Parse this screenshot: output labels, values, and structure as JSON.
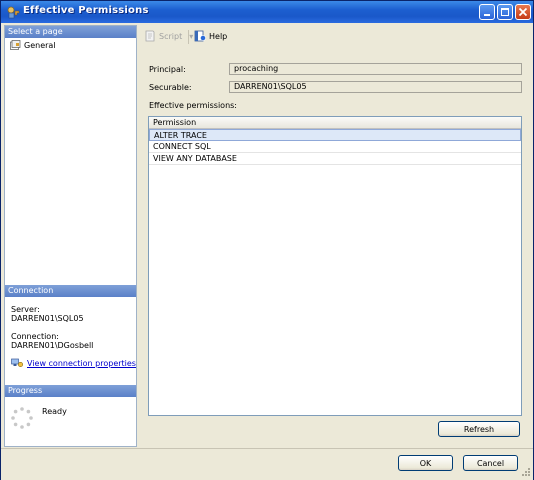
{
  "window": {
    "title": "Effective Permissions"
  },
  "left": {
    "select_page_header": "Select a page",
    "pages": [
      {
        "label": "General"
      }
    ],
    "connection_header": "Connection",
    "server_label": "Server:",
    "server_value": "DARREN01\\SQL05",
    "connection_label": "Connection:",
    "connection_value": "DARREN01\\DGosbell",
    "view_props_link": "View connection properties",
    "progress_header": "Progress",
    "progress_status": "Ready"
  },
  "toolbar": {
    "script_label": "Script",
    "help_label": "Help"
  },
  "form": {
    "principal_label": "Principal:",
    "principal_value": "procaching",
    "securable_label": "Securable:",
    "securable_value": "DARREN01\\SQL05",
    "effective_label": "Effective permissions:"
  },
  "grid": {
    "column_header": "Permission",
    "rows": [
      "ALTER TRACE",
      "CONNECT SQL",
      "VIEW ANY DATABASE"
    ]
  },
  "buttons": {
    "refresh": "Refresh",
    "ok": "OK",
    "cancel": "Cancel"
  }
}
